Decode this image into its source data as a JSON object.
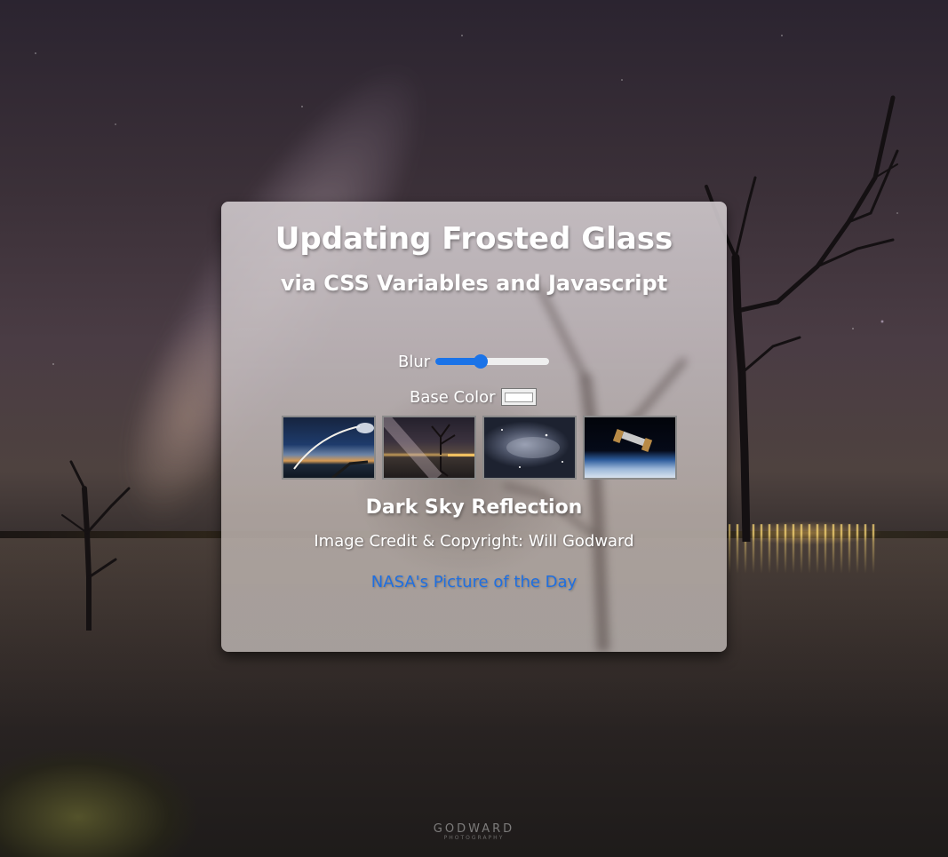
{
  "card": {
    "title": "Updating Frosted Glass",
    "subtitle": "via CSS Variables and Javascript"
  },
  "controls": {
    "blur_label": "Blur",
    "blur_value_fraction": 0.4,
    "base_color_label": "Base Color",
    "base_color_value": "#ffffff"
  },
  "thumbnails": [
    {
      "name": "rocket-launch-thumbnail",
      "icon": "rocket-launch-photo"
    },
    {
      "name": "dark-sky-reflection-thumbnail",
      "icon": "tree-reflection-photo"
    },
    {
      "name": "nebula-thumbnail",
      "icon": "nebula-photo"
    },
    {
      "name": "hubble-telescope-thumbnail",
      "icon": "space-telescope-photo"
    }
  ],
  "image_info": {
    "title": "Dark Sky Reflection",
    "credit": "Image Credit & Copyright: Will Godward",
    "link_text": "NASA's Picture of the Day"
  },
  "watermark": {
    "brand": "GODWARD",
    "sub": "PHOTOGRAPHY"
  },
  "colors": {
    "accent": "#1a73e8",
    "link": "#1f6fe0",
    "text": "#ffffff"
  }
}
